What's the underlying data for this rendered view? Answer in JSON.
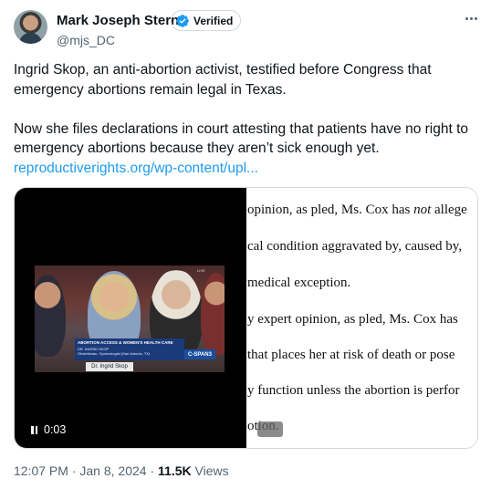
{
  "author": {
    "name": "Mark Joseph Stern",
    "verified_label": "Verified",
    "handle": "@mjs_DC"
  },
  "tweet": {
    "paragraph1": "Ingrid Skop, an anti-abortion activist, testified before Congress that emergency abortions remain legal in Texas.",
    "paragraph2": "Now she files declarations in court attesting that patients have no right to emergency abortions because they aren’t sick enough yet.",
    "link_text": "reproductiverights.org/wp-content/upl..."
  },
  "video": {
    "time": "0:03",
    "live_label": "LIVE",
    "chyron_title": "ABORTION ACCESS & WOMEN'S HEALTH CARE",
    "chyron_sub1": "DR. INGRID SKOP",
    "chyron_sub2": "Obstetrician, Gynecologist (San Antonio, TX)",
    "channel": "C-SPAN3",
    "nameplate": "Dr. Ingrid Skop"
  },
  "document": {
    "line1_pre": "opinion, as pled, Ms. Cox has ",
    "line1_em": "not",
    "line1_post": " allege",
    "line2": "cal condition aggravated by, caused by,",
    "line3": "medical exception.",
    "line4": "y expert opinion, as pled, Ms. Cox has",
    "line5": "that places her at risk of death or pose",
    "line6": "y function unless the abortion is perfor",
    "line7": "otion."
  },
  "meta": {
    "time": "12:07 PM",
    "sep1": " · ",
    "date": "Jan 8, 2024",
    "sep2": " · ",
    "views_count": "11.5K",
    "views_label": " Views"
  },
  "colors": {
    "link": "#1d9bf0",
    "verified_badge": "#1d9bf0",
    "muted": "#536471"
  },
  "icons": [
    "verified-badge-icon",
    "more-options-icon",
    "pause-icon"
  ]
}
